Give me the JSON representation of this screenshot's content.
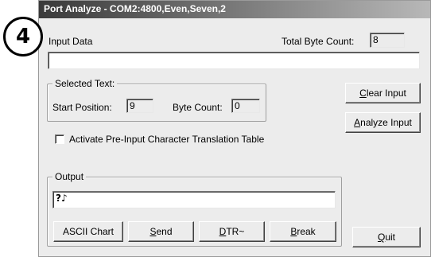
{
  "window": {
    "title": "Port Analyze - COM2:4800,Even,Seven,2"
  },
  "badge": {
    "step": "4"
  },
  "input_data": {
    "label": "Input Data",
    "value": "",
    "total_byte_label": "Total Byte Count:",
    "total_byte_value": "8"
  },
  "selected_text": {
    "title": "Selected Text:",
    "start_label": "Start Position:",
    "start_value": "9",
    "byte_label": "Byte Count:",
    "byte_value": "0"
  },
  "buttons": {
    "clear_input_mnemonic": "C",
    "clear_input_rest": "lear Input",
    "analyze_input_mnemonic": "A",
    "analyze_input_rest": "nalyze Input",
    "ascii_chart": "ASCII Chart",
    "send_mnemonic": "S",
    "send_rest": "end",
    "dtr_mnemonic": "D",
    "dtr_rest": "TR~",
    "break_mnemonic": "B",
    "break_rest": "reak",
    "quit_mnemonic": "Q",
    "quit_rest": "uit"
  },
  "translation": {
    "label": "Activate Pre-Input Character Translation Table",
    "checked": false
  },
  "output": {
    "title": "Output",
    "value": "?♪"
  }
}
